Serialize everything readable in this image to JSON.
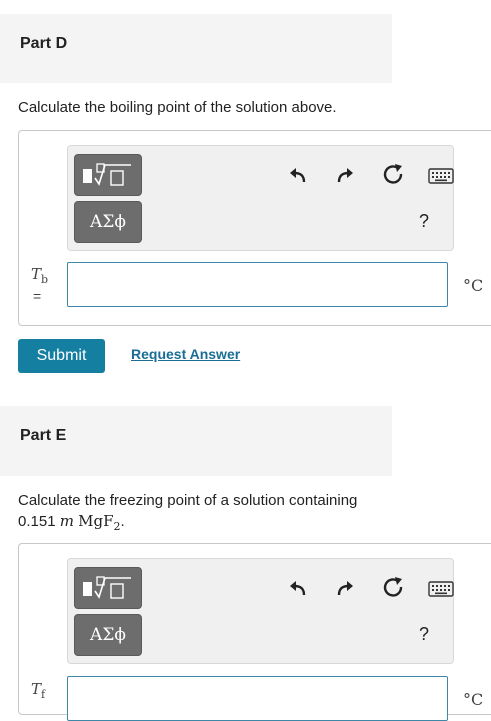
{
  "partD": {
    "title": "Part D",
    "question": "Calculate the boiling point of the solution above.",
    "variable": "T",
    "variable_sub": "b",
    "equals": "=",
    "unit": "°C",
    "input_value": "",
    "toolbar": {
      "symbols_label": "ΑΣϕ",
      "help_label": "?"
    },
    "submit_label": "Submit",
    "request_label": "Request Answer"
  },
  "partE": {
    "title": "Part E",
    "question_line1": "Calculate the freezing point of a solution containing",
    "question_line2_pre": "0.151 ",
    "question_molal": "m",
    "question_compound": "MgF",
    "question_sub": "2",
    "question_end": ".",
    "variable": "T",
    "variable_sub": "f",
    "unit": "°C",
    "input_value": "",
    "toolbar": {
      "symbols_label": "ΑΣϕ",
      "help_label": "?"
    }
  },
  "icons": {
    "templates": "fraction-root-template-icon",
    "undo": "undo-icon",
    "redo": "redo-icon",
    "reset": "reset-icon",
    "keyboard": "keyboard-icon"
  }
}
